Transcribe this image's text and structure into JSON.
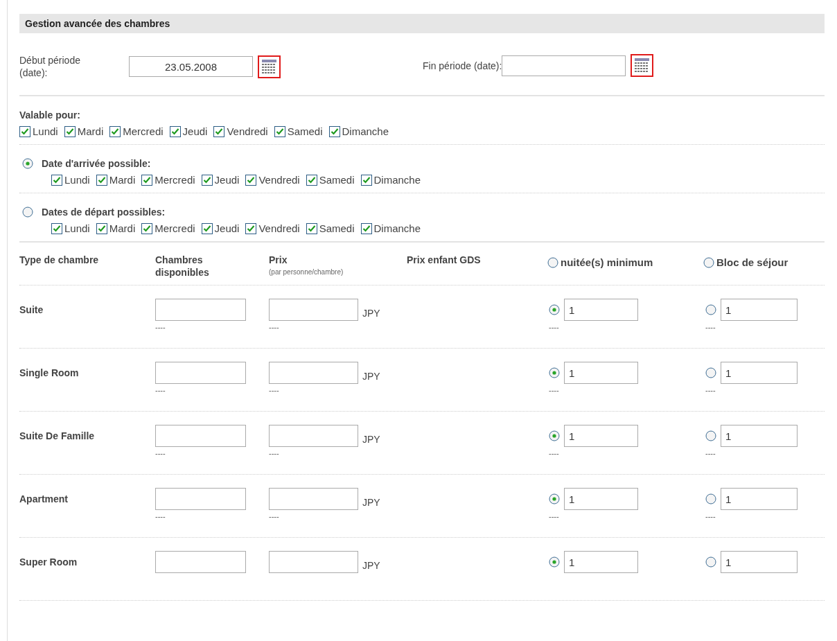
{
  "title": "Gestion avancée des chambres",
  "period": [
    {
      "label": "Début période (date):",
      "value": "23.05.2008"
    },
    {
      "label": "Fin période (date):"
    }
  ],
  "valid_for": {
    "label": "Valable pour:",
    "days": [
      {
        "label": "Lundi",
        "checked": true
      },
      {
        "label": "Mardi",
        "checked": true
      },
      {
        "label": "Mercredi",
        "checked": true
      },
      {
        "label": "Jeudi",
        "checked": true
      },
      {
        "label": "Vendredi",
        "checked": true
      },
      {
        "label": "Samedi",
        "checked": true
      },
      {
        "label": "Dimanche",
        "checked": true
      }
    ]
  },
  "options": [
    {
      "label": "Date d'arrivée possible:",
      "selected": true,
      "days": [
        {
          "label": "Lundi",
          "checked": true
        },
        {
          "label": "Mardi",
          "checked": true
        },
        {
          "label": "Mercredi",
          "checked": true
        },
        {
          "label": "Jeudi",
          "checked": true
        },
        {
          "label": "Vendredi",
          "checked": true
        },
        {
          "label": "Samedi",
          "checked": true
        },
        {
          "label": "Dimanche",
          "checked": true
        }
      ]
    },
    {
      "label": "Dates de départ possibles:",
      "selected": false,
      "days": [
        {
          "label": "Lundi",
          "checked": true
        },
        {
          "label": "Mardi",
          "checked": true
        },
        {
          "label": "Mercredi",
          "checked": true
        },
        {
          "label": "Jeudi",
          "checked": true
        },
        {
          "label": "Vendredi",
          "checked": true
        },
        {
          "label": "Samedi",
          "checked": true
        },
        {
          "label": "Dimanche",
          "checked": true
        }
      ]
    }
  ],
  "table": {
    "columns": [
      {
        "kind": "text",
        "label": "Type de chambre"
      },
      {
        "kind": "text",
        "label": "Chambres disponibles"
      },
      {
        "kind": "text",
        "label": "Prix",
        "note": "(par personne/chambre)"
      },
      {
        "kind": "text",
        "label": "Prix enfant GDS"
      },
      {
        "kind": "radio",
        "label": "nuitée(s) minimum",
        "selected": false
      },
      {
        "kind": "radio",
        "label": "Bloc de séjour",
        "selected": false
      }
    ],
    "rows": [
      {
        "name": "Suite",
        "rooms_note": "----",
        "currency": "JPY",
        "price_note": "----",
        "min_nights": {
          "selected": true,
          "value": "1",
          "note": "----"
        },
        "stay_block": {
          "selected": false,
          "value": "1",
          "note": "----"
        }
      },
      {
        "name": "Single Room",
        "rooms_note": "----",
        "currency": "JPY",
        "price_note": "----",
        "min_nights": {
          "selected": true,
          "value": "1",
          "note": "----"
        },
        "stay_block": {
          "selected": false,
          "value": "1",
          "note": "----"
        }
      },
      {
        "name": "Suite De Famille",
        "rooms_note": "----",
        "currency": "JPY",
        "price_note": "----",
        "min_nights": {
          "selected": true,
          "value": "1",
          "note": "----"
        },
        "stay_block": {
          "selected": false,
          "value": "1",
          "note": "----"
        }
      },
      {
        "name": "Apartment",
        "rooms_note": "----",
        "currency": "JPY",
        "price_note": "----",
        "min_nights": {
          "selected": true,
          "value": "1",
          "note": "----"
        },
        "stay_block": {
          "selected": false,
          "value": "1",
          "note": "----"
        }
      },
      {
        "name": "Super Room",
        "currency": "JPY",
        "min_nights": {
          "selected": true,
          "value": "1"
        },
        "stay_block": {
          "selected": false,
          "value": "1"
        }
      }
    ]
  }
}
